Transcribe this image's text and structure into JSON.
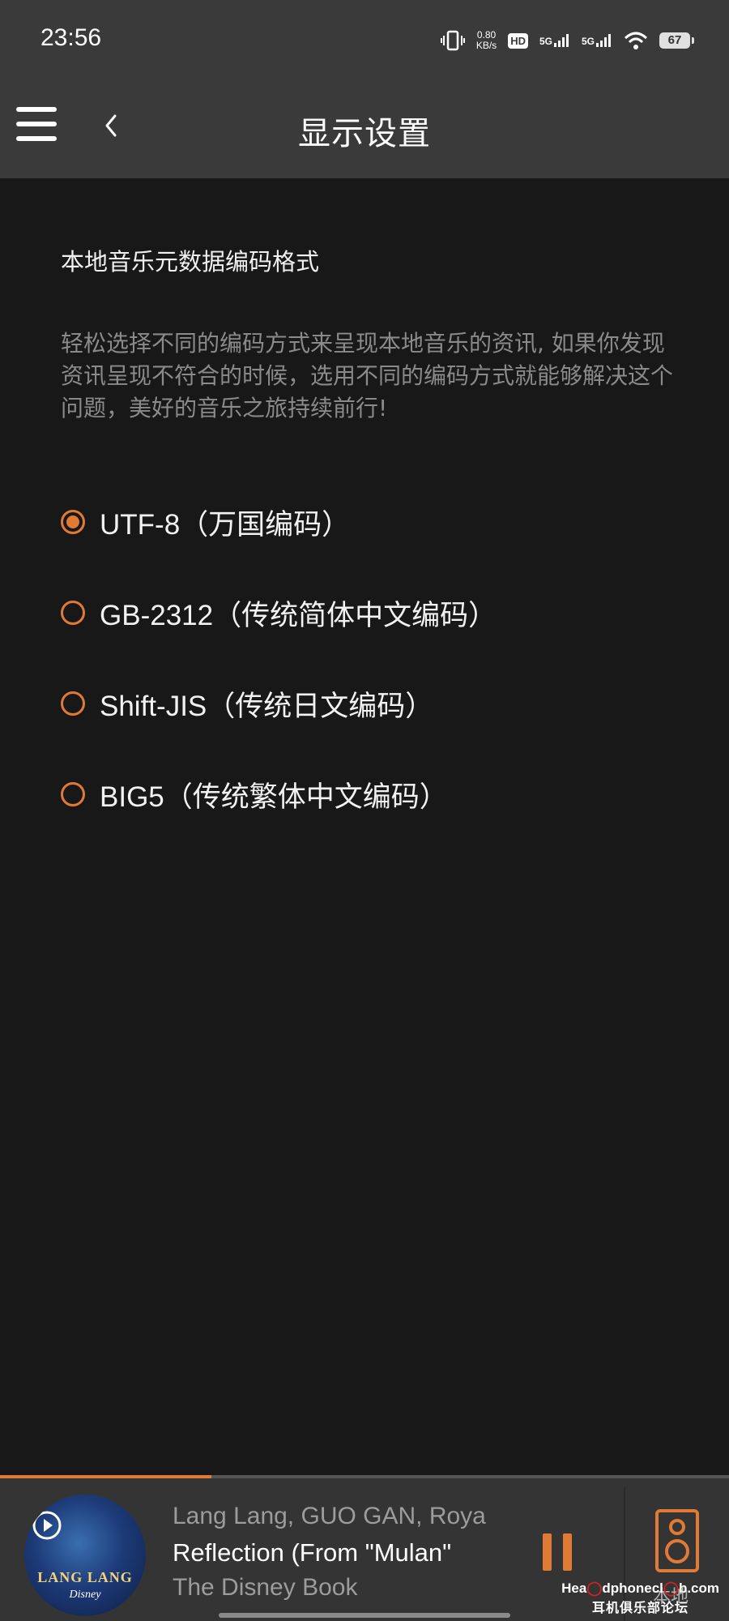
{
  "status_bar": {
    "time": "23:56",
    "net_speed_value": "0.80",
    "net_speed_unit": "KB/s",
    "hd_label": "HD",
    "sim1_label": "5G",
    "sim2_label": "5G",
    "battery": "67"
  },
  "header": {
    "title": "显示设置"
  },
  "section": {
    "title": "本地音乐元数据编码格式",
    "description": "轻松选择不同的编码方式来呈现本地音乐的资讯, 如果你发现资讯呈现不符合的时候，选用不同的编码方式就能够解决这个问题，美好的音乐之旅持续前行!"
  },
  "encoding_options": [
    {
      "label": "UTF-8（万国编码）",
      "selected": true
    },
    {
      "label": "GB-2312（传统简体中文编码）",
      "selected": false
    },
    {
      "label": "Shift-JIS（传统日文编码）",
      "selected": false
    },
    {
      "label": "BIG5（传统繁体中文编码）",
      "selected": false
    }
  ],
  "player": {
    "progress": 0.29,
    "artist": "Lang Lang, GUO GAN, Roya",
    "title": "Reflection (From \"Mulan\"",
    "album": "The Disney Book",
    "art_text": "LANG LANG",
    "art_subtext": "Disney",
    "local_label": "本地"
  },
  "watermark": {
    "brand_left": "Hea",
    "brand_mid": "dphonecl",
    "brand_right": "b.com",
    "brand_cn": "耳机俱乐部论坛"
  },
  "colors": {
    "accent": "#e07a35",
    "background": "#181818",
    "header_bg": "#3a3a3a"
  }
}
